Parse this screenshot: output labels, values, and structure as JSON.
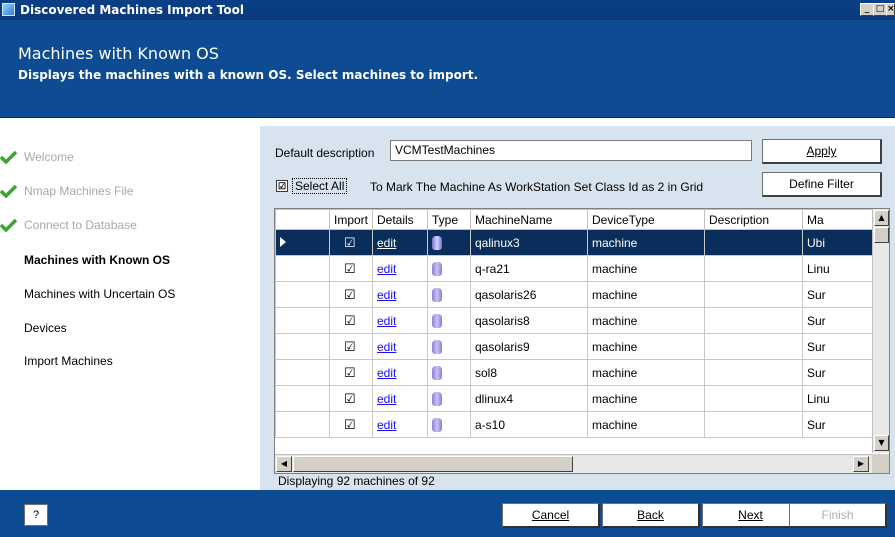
{
  "window": {
    "title": "Discovered Machines Import Tool",
    "min": "_",
    "max": "□",
    "close": "×"
  },
  "header": {
    "title": "Machines with Known OS",
    "subtitle": "Displays the machines with a known OS.  Select machines to import."
  },
  "nav": {
    "items": [
      {
        "label": "Welcome",
        "state": "done"
      },
      {
        "label": "Nmap Machines File",
        "state": "done"
      },
      {
        "label": "Connect to Database",
        "state": "done"
      },
      {
        "label": "Machines with Known OS",
        "state": "active"
      },
      {
        "label": "Machines with Uncertain OS",
        "state": "pending"
      },
      {
        "label": "Devices",
        "state": "pending"
      },
      {
        "label": "Import Machines",
        "state": "pending"
      }
    ]
  },
  "form": {
    "desc_label": "Default description",
    "desc_value": "VCMTestMachines",
    "apply_label": "Apply",
    "filter_label": "Define Filter",
    "select_all_label": "Select All",
    "select_all_checked": "☑",
    "hint": "To Mark The Machine As WorkStation Set Class Id as 2 in Grid"
  },
  "grid": {
    "columns": [
      "",
      "Import",
      "Details",
      "Type",
      "MachineName",
      "DeviceType",
      "Description",
      "Ma"
    ],
    "rows": [
      {
        "mark": "▶",
        "import": "☑",
        "details": "edit",
        "name": "qalinux3",
        "device": "machine",
        "desc": "",
        "ma": "Ubi"
      },
      {
        "mark": "",
        "import": "☑",
        "details": "edit",
        "name": "q-ra21",
        "device": "machine",
        "desc": "",
        "ma": "Linu"
      },
      {
        "mark": "",
        "import": "☑",
        "details": "edit",
        "name": "qasolaris26",
        "device": "machine",
        "desc": "",
        "ma": "Sur"
      },
      {
        "mark": "",
        "import": "☑",
        "details": "edit",
        "name": "qasolaris8",
        "device": "machine",
        "desc": "",
        "ma": "Sur"
      },
      {
        "mark": "",
        "import": "☑",
        "details": "edit",
        "name": "qasolaris9",
        "device": "machine",
        "desc": "",
        "ma": "Sur"
      },
      {
        "mark": "",
        "import": "☑",
        "details": "edit",
        "name": "sol8",
        "device": "machine",
        "desc": "",
        "ma": "Sur"
      },
      {
        "mark": "",
        "import": "☑",
        "details": "edit",
        "name": "dlinux4",
        "device": "machine",
        "desc": "",
        "ma": "Linu"
      },
      {
        "mark": "",
        "import": "☑",
        "details": "edit",
        "name": "a-s10",
        "device": "machine",
        "desc": "",
        "ma": "Sur"
      }
    ],
    "scroll_up": "▲",
    "scroll_down": "▼",
    "scroll_left": "◀",
    "scroll_right": "▶",
    "status": "Displaying 92 machines of 92"
  },
  "footer": {
    "help": "?",
    "cancel": "Cancel",
    "back": "Back",
    "next": "Next",
    "finish": "Finish"
  },
  "colors": {
    "header_bg": "#0d4c92",
    "panel_bg": "#d7e3ef",
    "selected_row": "#0a2e5c",
    "check_green": "#3aa62f"
  },
  "icons": {
    "done": "checkmark-icon",
    "type": "database-icon",
    "row_selected": "row-pointer-icon"
  }
}
